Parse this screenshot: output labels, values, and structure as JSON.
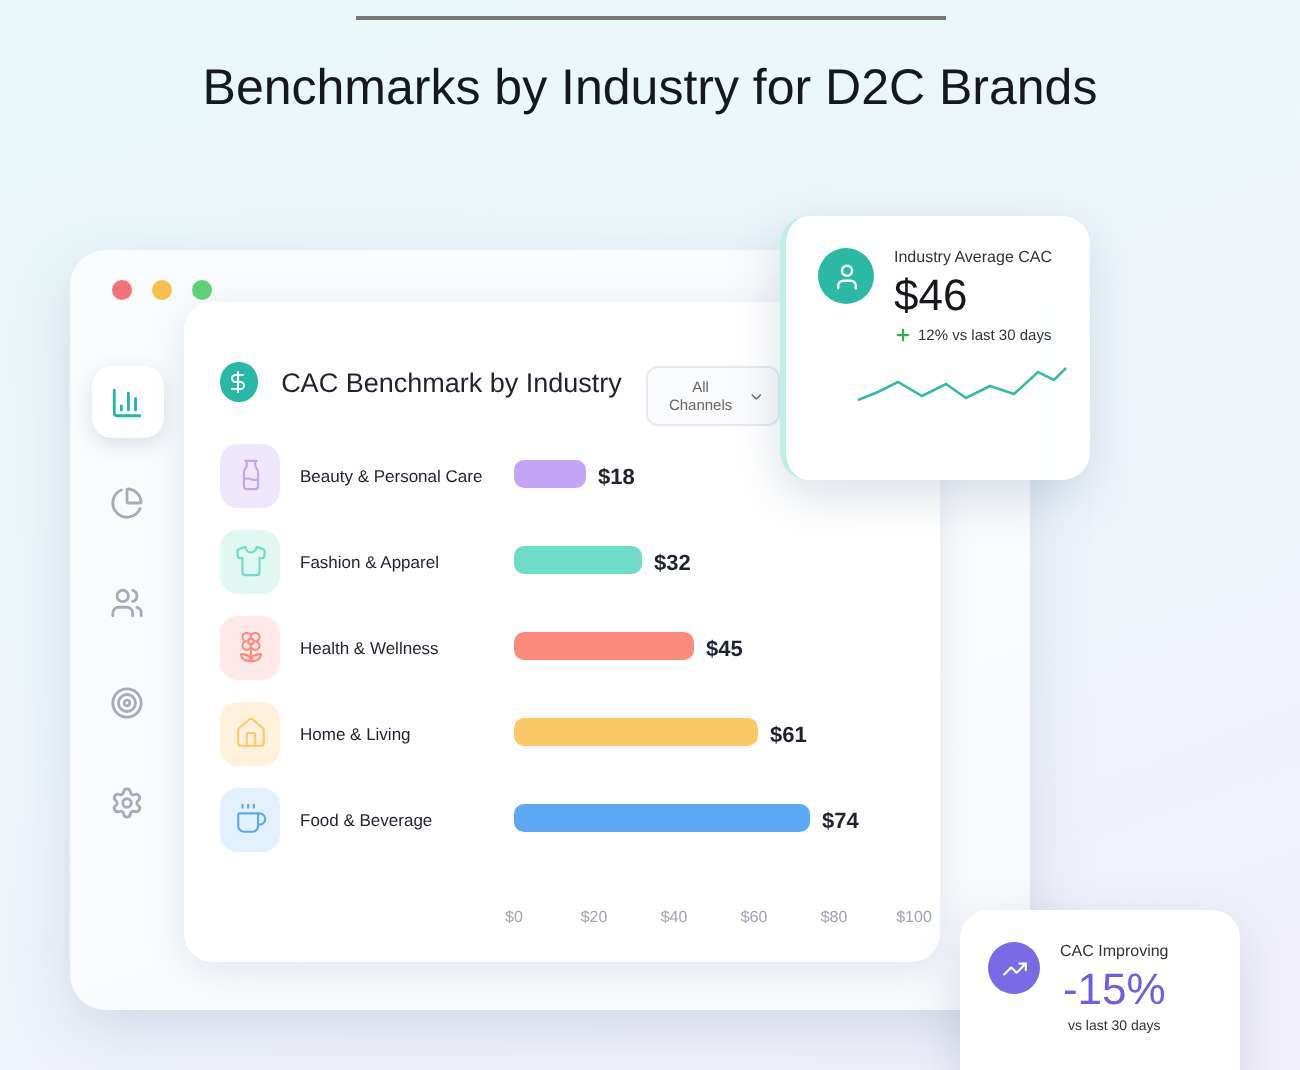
{
  "page_title": "Benchmarks by Industry for D2C Brands",
  "sidebar": {
    "items": [
      {
        "selected": true
      },
      {
        "selected": false
      },
      {
        "selected": false
      },
      {
        "selected": false
      },
      {
        "selected": false
      }
    ]
  },
  "card": {
    "title": "CAC Benchmark by Industry",
    "filter": {
      "value": "All Channels"
    },
    "chart_data": {
      "type": "bar",
      "orientation": "horizontal",
      "categories": [
        "Beauty & Personal Care",
        "Fashion & Apparel",
        "Health & Wellness",
        "Home & Living",
        "Food & Beverage"
      ],
      "values": [
        18,
        32,
        45,
        61,
        74
      ],
      "colors": [
        "#c4a5f5",
        "#6fdcc8",
        "#fb8a7c",
        "#fdc867",
        "#5ba9f5"
      ],
      "value_labels": [
        "$18",
        "$32",
        "$45",
        "$61",
        "$74"
      ],
      "xlim": [
        0,
        100
      ],
      "xticks": [
        {
          "value": 0,
          "label": "$0"
        },
        {
          "value": 20,
          "label": "$20"
        },
        {
          "value": 40,
          "label": "$40"
        },
        {
          "value": 60,
          "label": "$60"
        },
        {
          "value": 80,
          "label": "$80"
        },
        {
          "value": 100,
          "label": "$100"
        }
      ]
    }
  },
  "avg_card": {
    "label": "Industry Average CAC",
    "value": "$46",
    "change": "12% vs last 30 days"
  },
  "improve_card": {
    "label": "CAC Improving",
    "value": "-15%",
    "note": "vs last 30 days"
  }
}
